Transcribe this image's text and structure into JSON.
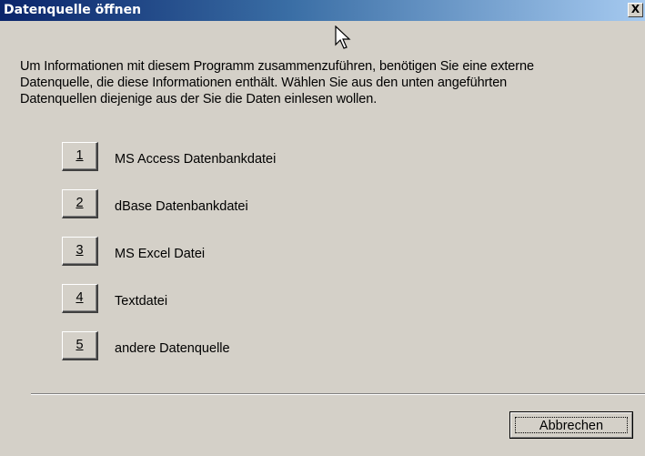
{
  "window": {
    "title": "Datenquelle öffnen",
    "close_glyph": "X"
  },
  "intro": {
    "lines": [
      "Um Informationen mit diesem Programm zusammenzuführen, benötigen Sie eine externe",
      "Datenquelle, die diese Informationen enthält. Wählen Sie aus den unten angeführten",
      "Datenquellen diejenige aus der Sie die Daten einlesen wollen."
    ]
  },
  "options": [
    {
      "key": "1",
      "label": "MS Access Datenbankdatei"
    },
    {
      "key": "2",
      "label": "dBase Datenbankdatei"
    },
    {
      "key": "3",
      "label": "MS Excel Datei"
    },
    {
      "key": "4",
      "label": "Textdatei"
    },
    {
      "key": "5",
      "label": "andere Datenquelle"
    }
  ],
  "footer": {
    "cancel_label": "Abbrechen"
  },
  "icons": {
    "cursor": "mouse-pointer-icon",
    "close": "close-icon"
  }
}
